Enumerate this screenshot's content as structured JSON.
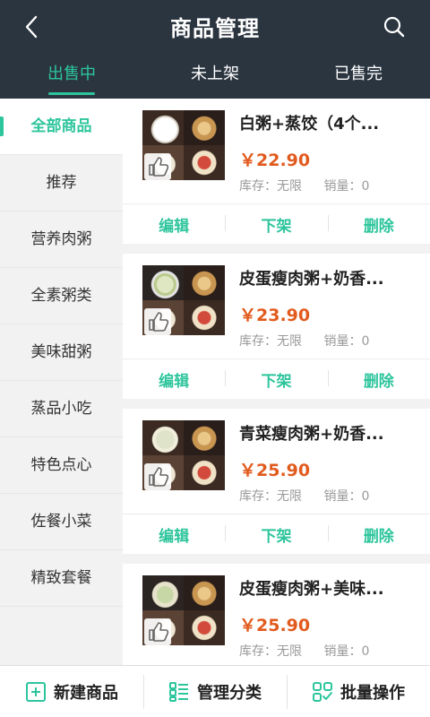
{
  "header": {
    "title": "商品管理"
  },
  "tabs": [
    {
      "label": "出售中",
      "active": true
    },
    {
      "label": "未上架",
      "active": false
    },
    {
      "label": "已售完",
      "active": false
    }
  ],
  "sidebar": {
    "items": [
      {
        "label": "全部商品",
        "active": true
      },
      {
        "label": "推荐",
        "active": false
      },
      {
        "label": "营养肉粥",
        "active": false
      },
      {
        "label": "全素粥类",
        "active": false
      },
      {
        "label": "美味甜粥",
        "active": false
      },
      {
        "label": "蒸品小吃",
        "active": false
      },
      {
        "label": "特色点心",
        "active": false
      },
      {
        "label": "佐餐小菜",
        "active": false
      },
      {
        "label": "精致套餐",
        "active": false
      }
    ]
  },
  "products": [
    {
      "name": "白粥+蒸饺（4个...",
      "price": "￥22.90",
      "stock": "库存：无限",
      "sales": "销量：0"
    },
    {
      "name": "皮蛋瘦肉粥+奶香...",
      "price": "￥23.90",
      "stock": "库存：无限",
      "sales": "销量：0"
    },
    {
      "name": "青菜瘦肉粥+奶香...",
      "price": "￥25.90",
      "stock": "库存：无限",
      "sales": "销量：0"
    },
    {
      "name": "皮蛋瘦肉粥+美味...",
      "price": "￥25.90",
      "stock": "库存：无限",
      "sales": "销量：0"
    }
  ],
  "actions": {
    "edit": "编辑",
    "unshelve": "下架",
    "delete": "删除"
  },
  "bottom_bar": {
    "new_product": "新建商品",
    "manage_category": "管理分类",
    "batch_operation": "批量操作"
  },
  "colors": {
    "accent": "#2dc59c",
    "header_bg": "#2b3540",
    "price": "#e25b1e"
  },
  "icons": [
    "back-arrow-icon",
    "search-icon",
    "thumbs-up-icon",
    "plus-square-icon",
    "category-list-icon",
    "batch-check-icon"
  ]
}
